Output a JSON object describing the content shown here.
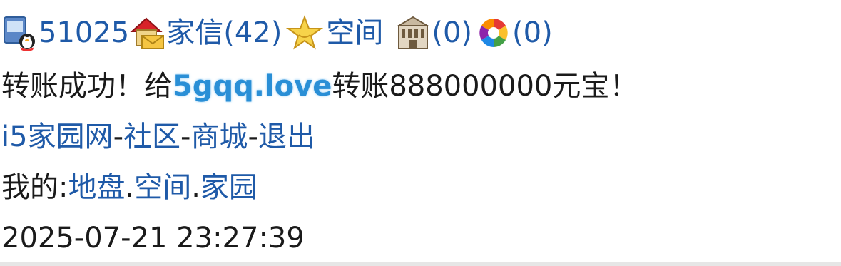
{
  "top_bar": {
    "user_id": "51025",
    "mail_label": "家信(42)",
    "space_label": "空间",
    "building_count": "(0)",
    "camera_count": "(0)"
  },
  "transfer_message": {
    "prefix": "转账成功！给",
    "recipient": "5gqq.love",
    "suffix": "转账888000000元宝！"
  },
  "nav": {
    "home": "i5家园网",
    "sep1": "-",
    "community": "社区",
    "sep2": "-",
    "mall": "商城",
    "sep3": "-",
    "logout": "退出"
  },
  "mine": {
    "label": "我的:",
    "land": "地盘",
    "dot1": ".",
    "space": "空间",
    "dot2": ".",
    "home": "家园"
  },
  "timestamp": "2025-07-21 23:27:39",
  "icons": {
    "user": "qq-user-icon",
    "mail": "house-mail-icon",
    "space": "star-icon",
    "building": "building-icon",
    "camera": "aperture-icon"
  }
}
